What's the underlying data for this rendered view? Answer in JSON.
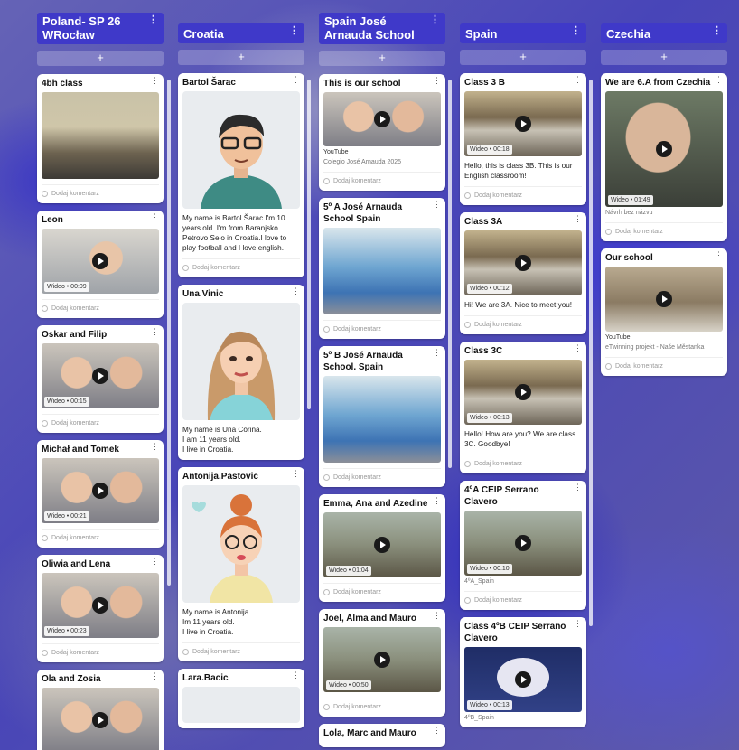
{
  "ui": {
    "comment_label": "Dodaj komentarz",
    "add_symbol": "+",
    "kebab": "⋮"
  },
  "columns": [
    {
      "title": "Poland- SP 26 WRocław",
      "cards": [
        {
          "title": "4bh class"
        },
        {
          "title": "Leon",
          "video": "Wideo • 00:09"
        },
        {
          "title": "Oskar and Filip",
          "video": "Wideo • 00:15"
        },
        {
          "title": "Michał and Tomek",
          "video": "Wideo • 00:21"
        },
        {
          "title": "Oliwia and Lena",
          "video": "Wideo • 00:23"
        },
        {
          "title": "Ola and Zosia"
        }
      ]
    },
    {
      "title": "Croatia",
      "cards": [
        {
          "title": "Bartol Šarac",
          "text": "My name is Bartol Šarac.I'm 10 years old. I'm from Baranjsko Petrovo Selo in Croatia.I love to play football and I love english."
        },
        {
          "title": "Una.Vinic",
          "text": "My name is Una Corina.\nI am 11 years old.\nI live in Croatia."
        },
        {
          "title": "Antonija.Pastovic",
          "text": "My name is Antonija.\nIm 11 years old.\nI live in Croatia."
        },
        {
          "title": "Lara.Bacic"
        }
      ]
    },
    {
      "title": "Spain José Arnauda School",
      "cards": [
        {
          "title": "This is our school",
          "source": "YouTube",
          "sub": "Colegio José Arnauda 2025"
        },
        {
          "title": "5º A José Arnauda School Spain"
        },
        {
          "title": "5º B José Arnauda School. Spain"
        },
        {
          "title": "Emma, Ana and Azedine",
          "video": "Wideo • 01:04"
        },
        {
          "title": "Joel, Alma and Mauro",
          "video": "Wideo • 00:50"
        },
        {
          "title": "Lola, Marc and Mauro"
        }
      ]
    },
    {
      "title": "Spain",
      "cards": [
        {
          "title": "Class 3 B",
          "video": "Wideo • 00:18",
          "text": "Hello, this is class 3B. This is our English classroom!"
        },
        {
          "title": "Class 3A",
          "video": "Wideo • 00:12",
          "text": "Hi! We are 3A. Nice to meet you!"
        },
        {
          "title": "Class 3C",
          "video": "Wideo • 00:13",
          "text": "Hello! How are you? We are class 3C. Goodbye!"
        },
        {
          "title": "4ºA CEIP Serrano Clavero",
          "video": "Wideo • 00:10",
          "sub": "4ºA_Spain"
        },
        {
          "title": "Class 4ºB CEIP Serrano Clavero",
          "video": "Wideo • 00:13",
          "sub": "4ºB_Spain"
        }
      ]
    },
    {
      "title": "Czechia",
      "cards": [
        {
          "title": "We are 6.A from Czechia",
          "video": "Wideo • 01:49",
          "sub": "Návrh bez názvu"
        },
        {
          "title": "Our school",
          "source": "YouTube",
          "sub": "eTwinning projekt - Naše Městanka"
        }
      ]
    }
  ]
}
